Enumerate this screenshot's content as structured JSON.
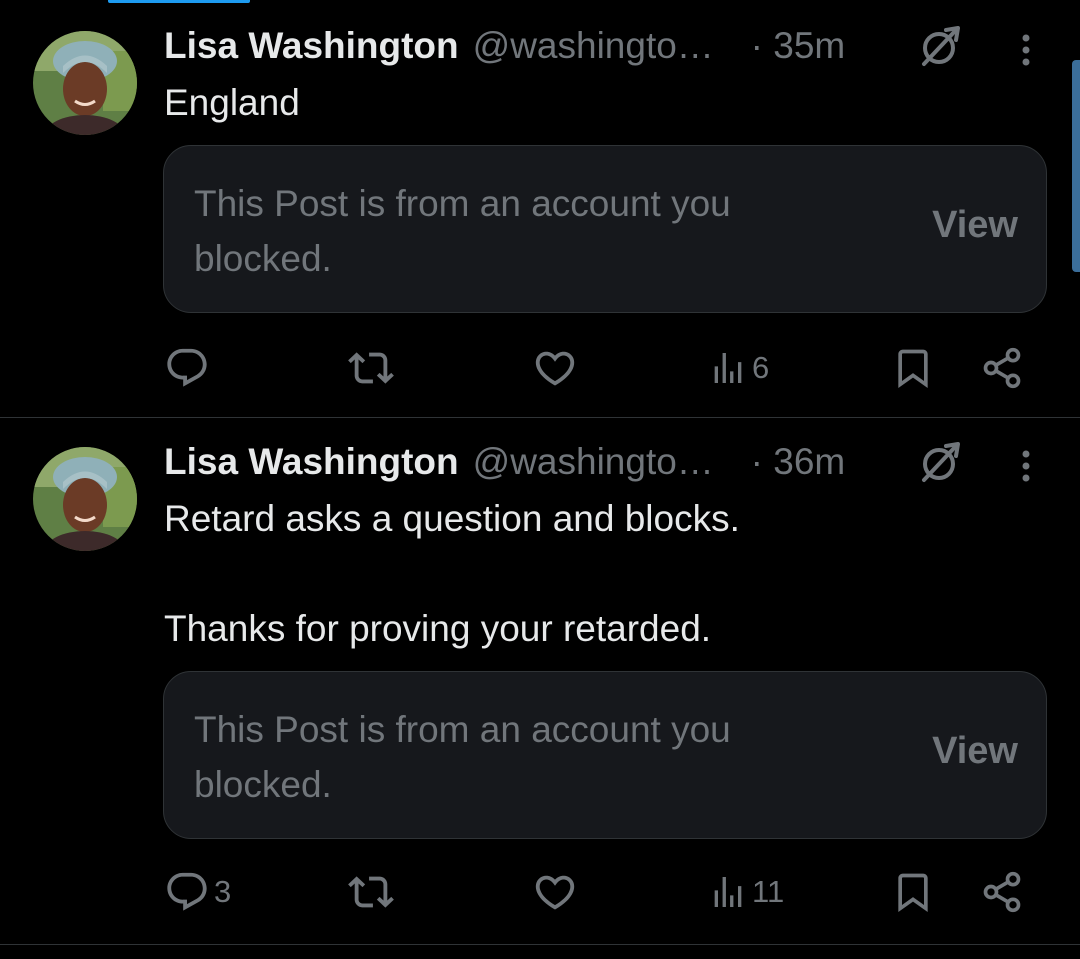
{
  "colors": {
    "background": "#000000",
    "text_primary": "#e7e9ea",
    "text_secondary": "#71767b",
    "card_background": "#16181c",
    "divider": "#2f3336",
    "accent": "#1d9bf0"
  },
  "posts": [
    {
      "author_name": "Lisa Washington",
      "author_handle": "@washingto…",
      "time": "· 35m",
      "text": "England",
      "blocked_notice": "This Post is from an account you blocked.",
      "view_label": "View",
      "replies": "",
      "views": "6",
      "icons": [
        "reply-icon",
        "repost-icon",
        "like-icon",
        "views-icon",
        "bookmark-icon",
        "share-icon",
        "grok-icon",
        "more-icon"
      ]
    },
    {
      "author_name": "Lisa Washington",
      "author_handle": "@washingto…",
      "time": "· 36m",
      "text": "Retard asks a question and blocks.\n\nThanks for proving your retarded.",
      "blocked_notice": "This Post is from an account you blocked.",
      "view_label": "View",
      "replies": "3",
      "views": "11",
      "icons": [
        "reply-icon",
        "repost-icon",
        "like-icon",
        "views-icon",
        "bookmark-icon",
        "share-icon",
        "grok-icon",
        "more-icon"
      ]
    }
  ]
}
